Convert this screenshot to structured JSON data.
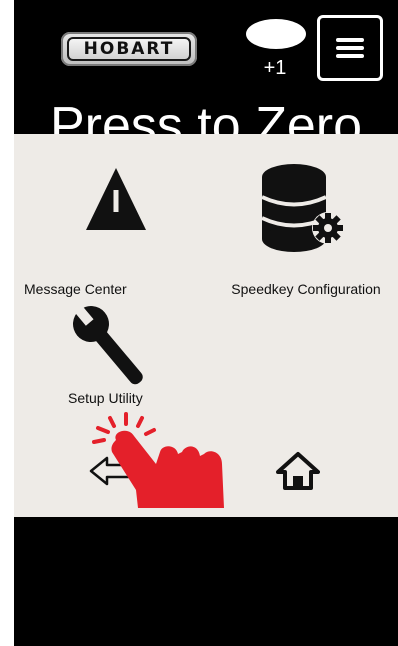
{
  "header": {
    "brand": "HOBART",
    "badge_count": "+1",
    "page_title": "Press to Zero"
  },
  "tiles": {
    "message_center": {
      "label": "Message Center",
      "icon": "warning-triangle-icon"
    },
    "speedkey_configuration": {
      "label": "Speedkey Configuration",
      "icon": "database-gear-icon"
    },
    "setup_utility": {
      "label": "Setup Utility",
      "icon": "wrench-icon"
    }
  },
  "nav": {
    "back_icon": "arrow-left-icon",
    "home_icon": "home-icon"
  },
  "colors": {
    "screen_bg": "#000000",
    "panel_bg": "#eeebe7",
    "hand": "#e4202a"
  }
}
